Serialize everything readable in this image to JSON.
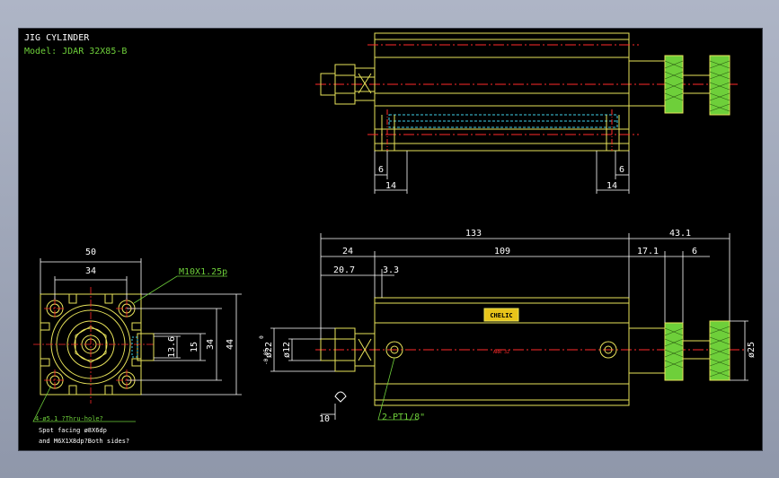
{
  "title": {
    "line1": "JIG CYLINDER",
    "line2": "Model: JDAR 32X85-B"
  },
  "colors": {
    "background": "#000000",
    "outline": "#e8e35a",
    "dimension": "#ffffff",
    "center_line": "#ff2a2a",
    "hidden_line": "#3fd0e8",
    "knurl": "#6ecf3a",
    "leader": "#6ecf3a"
  },
  "dimensions": {
    "top_left_6": "6",
    "top_left_14": "14",
    "top_right_6": "6",
    "top_right_14": "14",
    "overall_133": "133",
    "rod_43_1": "43.1",
    "flange_24": "24",
    "body_109": "109",
    "rod_17_1": "17.1",
    "rod_6": "6",
    "nut_20_7": "20.7",
    "nut_3_3": "3.3",
    "end_10": "10",
    "dia_12": "ø12",
    "dia_22": "ø22",
    "dia_22_tol_upper": "0",
    "dia_22_tol_lower": "-0.05",
    "dia_25": "ø25",
    "port_label": "2-PT1/8\"",
    "front_50": "50",
    "front_34_top": "34",
    "front_thread": "M10X1.25p",
    "front_13_6": "13.6",
    "front_15": "15",
    "front_34_side": "34",
    "front_44": "44"
  },
  "notes": {
    "hole_note_1": "4-ø5.1 ?Thru-hole?",
    "hole_note_2": "Spot facing ø8X6dp",
    "hole_note_3": "and M6X1X8dp?Both sides?"
  },
  "body_text": {
    "nameplate": "CHELIC",
    "arrow_text": "ARR 32"
  }
}
